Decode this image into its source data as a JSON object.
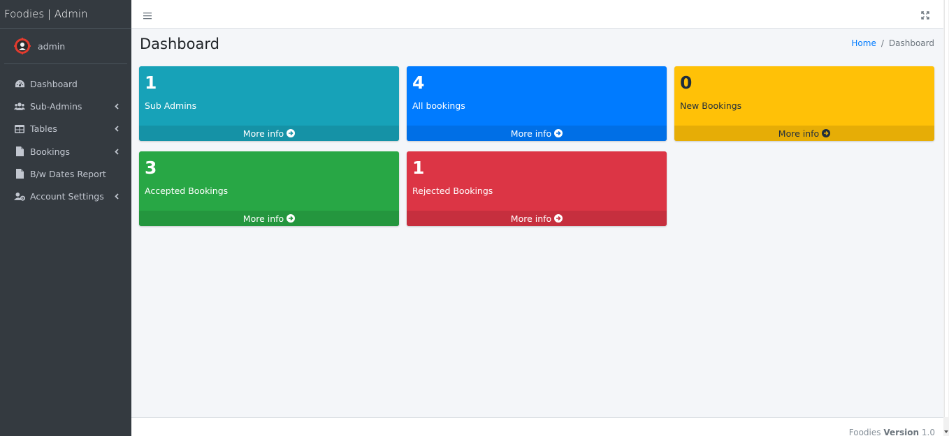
{
  "brand": {
    "title": "Foodies | Admin"
  },
  "user": {
    "name": "admin"
  },
  "sidebar": {
    "items": [
      {
        "label": "Dashboard",
        "icon": "dashboard-icon",
        "has_children": false
      },
      {
        "label": "Sub-Admins",
        "icon": "users-icon",
        "has_children": true
      },
      {
        "label": "Tables",
        "icon": "table-icon",
        "has_children": true
      },
      {
        "label": "Bookings",
        "icon": "file-icon",
        "has_children": true
      },
      {
        "label": "B/w Dates Report",
        "icon": "file-icon",
        "has_children": false
      },
      {
        "label": "Account Settings",
        "icon": "user-cog-icon",
        "has_children": true
      }
    ]
  },
  "header": {
    "title": "Dashboard",
    "breadcrumb": {
      "home": "Home",
      "separator": "/",
      "current": "Dashboard"
    }
  },
  "boxes": [
    {
      "count": "1",
      "label": "Sub Admins",
      "link": "More info",
      "color": "#17a2b8"
    },
    {
      "count": "4",
      "label": "All bookings",
      "link": "More info",
      "color": "#007bff"
    },
    {
      "count": "0",
      "label": "New Bookings",
      "link": "More info",
      "color": "#ffc107"
    },
    {
      "count": "3",
      "label": "Accepted Bookings",
      "link": "More info",
      "color": "#28a745"
    },
    {
      "count": "1",
      "label": "Rejected Bookings",
      "link": "More info",
      "color": "#dc3545"
    }
  ],
  "footer": {
    "app": "Foodies",
    "version_label": "Version",
    "version": "1.0"
  },
  "colors": {
    "sidebar_bg": "#343a40",
    "content_bg": "#f4f6f9",
    "link": "#007bff"
  }
}
